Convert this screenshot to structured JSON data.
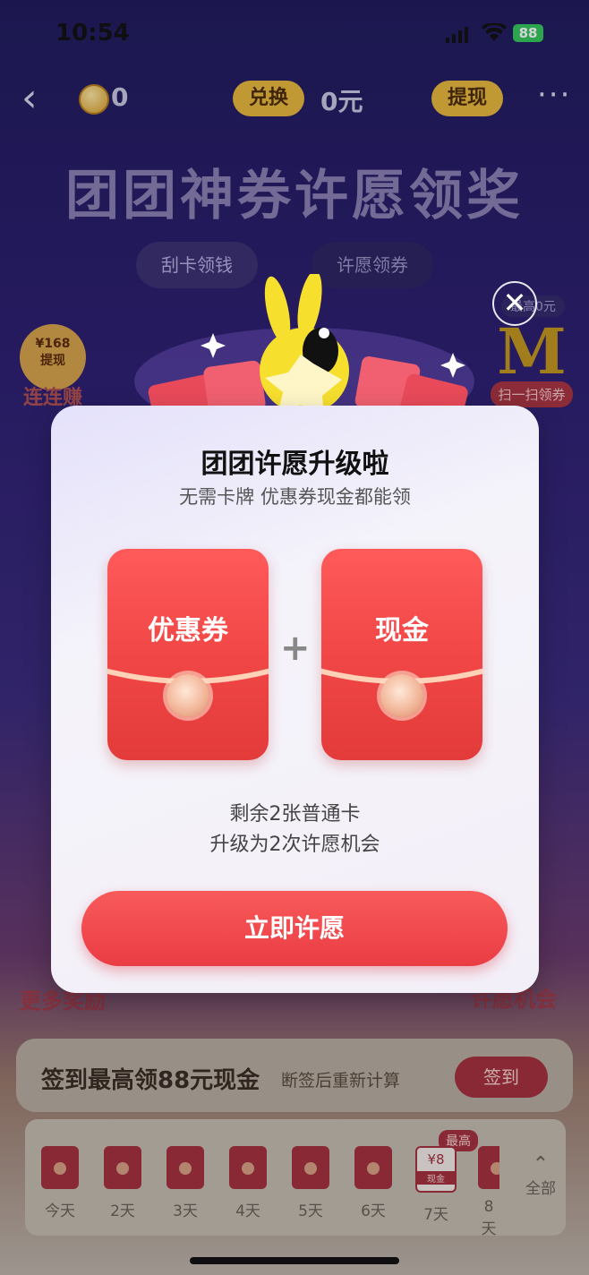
{
  "status_bar": {
    "time": "10:54",
    "battery": "88"
  },
  "nav": {
    "coin_count": "0",
    "exchange": "兑换",
    "balance": "0元",
    "withdraw": "提现",
    "more": "···"
  },
  "page": {
    "title": "团团神券许愿领奖",
    "tabs": [
      "刮卡领钱",
      "许愿领券"
    ],
    "left_badge_amount": "¥168",
    "left_badge_text": "提现",
    "left_label": "连连赚",
    "right_top_tag": "最高0元",
    "right_label": "扫一扫领券",
    "bottom_left_label": "更多奖励",
    "bottom_right_label": "许愿机会"
  },
  "checkin": {
    "title": "签到最高领88元现金",
    "note": "断签后重新计算",
    "button": "签到",
    "max_tag": "最高",
    "highlight_amount": "¥8",
    "highlight_sub": "现金",
    "days": [
      "今天",
      "2天",
      "3天",
      "4天",
      "5天",
      "6天",
      "7天",
      "8天"
    ],
    "all_label": "全部"
  },
  "modal": {
    "title": "团团许愿升级啦",
    "subtitle": "无需卡牌 优惠券现金都能领",
    "card_left": "优惠券",
    "card_right": "现金",
    "plus": "+",
    "info_line1": "剩余2张普通卡",
    "info_line2": "升级为2次许愿机会",
    "cta": "立即许愿",
    "close": "✕"
  }
}
